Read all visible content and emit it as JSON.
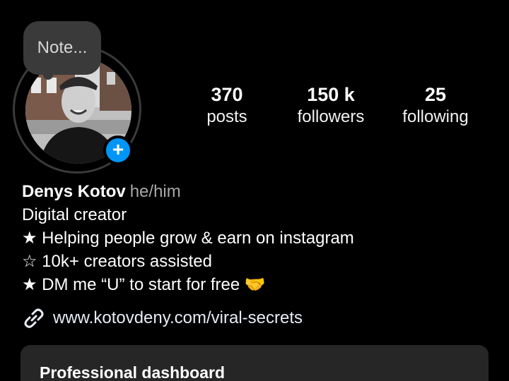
{
  "note": {
    "placeholder": "Note..."
  },
  "profile": {
    "name": "Denys Kotov",
    "pronouns": "he/him",
    "category": "Digital creator"
  },
  "stats": [
    {
      "value": "370",
      "label": "posts"
    },
    {
      "value": "150 k",
      "label": "followers"
    },
    {
      "value": "25",
      "label": "following"
    }
  ],
  "bio_lines": [
    "★ Helping people grow & earn on instagram",
    "☆ 10k+ creators assisted",
    "★ DM me “U” to start for free 🤝"
  ],
  "link": {
    "url": "www.kotovdeny.com/viral-secrets"
  },
  "dashboard": {
    "title": "Professional dashboard"
  },
  "colors": {
    "background": "#000000",
    "accent_blue": "#0095f6",
    "card": "#262626",
    "muted_text": "#a8a8a8"
  },
  "icons": {
    "add": "plus-icon",
    "link": "link-chain-icon"
  }
}
